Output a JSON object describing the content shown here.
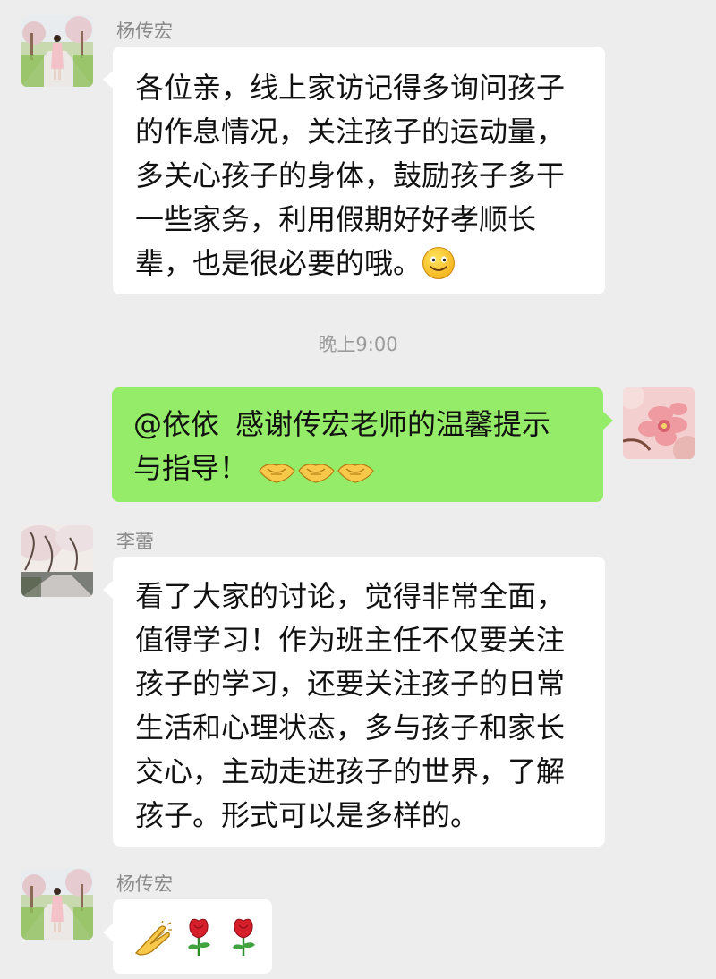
{
  "messages": [
    {
      "sender": "杨传宏",
      "avatar": "garden-path-portrait",
      "lines": [
        "各位亲，线上家访记得多询问孩子",
        "的作息情况，关注孩子的运动量，",
        "多关心孩子的身体，鼓励孩子多干",
        "一些家务，利用假期好好孝顺长",
        "辈，也是很必要的哦。"
      ],
      "emoji": "smile-emoji"
    },
    {
      "time": "晚上9:00"
    },
    {
      "mention": "@依依",
      "lines": [
        "感谢传宏老师的温馨提示",
        "与指导！"
      ],
      "emoji": "handshake-emoji",
      "avatar": "peach-blossom"
    },
    {
      "sender": "李蕾",
      "avatar": "cherry-tree-path",
      "lines": [
        "看了大家的讨论，觉得非常全面，",
        "值得学习！作为班主任不仅要关注",
        "孩子的学习，还要关注孩子的日常",
        "生活和心理状态，多与孩子和家长",
        "交心，主动走进孩子的世界，了解",
        "孩子。形式可以是多样的。"
      ]
    },
    {
      "sender": "杨传宏",
      "avatar": "garden-path-portrait",
      "emoji": [
        "clap-emoji",
        "rose-emoji",
        "rose-emoji"
      ]
    }
  ],
  "colors": {
    "background": "#ededed",
    "incoming": "#ffffff",
    "outgoing": "#95ec69",
    "sender": "#8a8a8a"
  }
}
